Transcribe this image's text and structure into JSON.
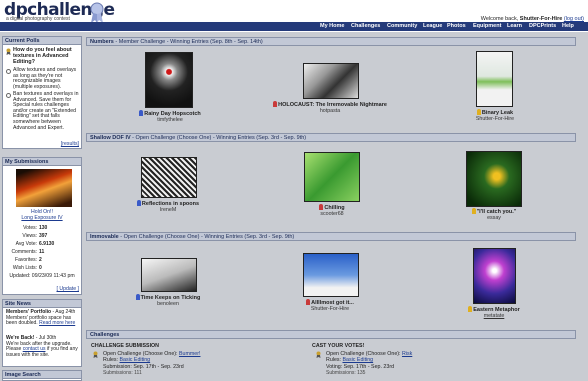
{
  "header": {
    "logo": "dpchallenge",
    "tagline": "a digital photography contest",
    "welcome_prefix": "Welcome back,",
    "username": "Shutter-For-Hire",
    "logout": "(log out)"
  },
  "nav": [
    "My Home",
    "Challenges",
    "Community",
    "League",
    "Photos",
    "Equipment",
    "Learn",
    "DPCPrints",
    "Help"
  ],
  "sidebar": {
    "polls_title": "Current Polls",
    "poll_question": "How do you feel about textures in Advanced Editing?",
    "poll_options": [
      "Allow textures and overlays as long as they're not recognizable images (multiple exposures).",
      "Ban textures and overlays in Advanced. Save them for Special rules challenges and/or create an \"Extended Editing\" set that falls somewhere between Advanced and Expert."
    ],
    "results_link": "[results]",
    "submissions_title": "My Submissions",
    "submission_status": "Hold On!!",
    "submission_challenge": "Long Exposure IV",
    "stats": [
      {
        "label": "Votes:",
        "value": "130"
      },
      {
        "label": "Views:",
        "value": "397"
      },
      {
        "label": "Avg Vote:",
        "value": "6.9130"
      },
      {
        "label": "Comments:",
        "value": "11"
      },
      {
        "label": "Favorites:",
        "value": "2"
      },
      {
        "label": "Wish Lists:",
        "value": "0"
      }
    ],
    "updated": "Updated: 09/23/09 11:43 pm",
    "update_link": "[ Update ]",
    "news_title": "Site News",
    "news_items": [
      {
        "headline": "Members' Portfolio",
        "date": "- Aug 24th",
        "text": "Members' portfolio space has been doubled.",
        "link": "Read more here"
      },
      {
        "headline": "We're Back!",
        "date": "- Jul 30th",
        "text": "We're back after the upgrade. Please",
        "link": "contact us",
        "text2": "if you find any issues with the site."
      }
    ],
    "image_search_title": "Image Search"
  },
  "sections": [
    {
      "name": "Numbers",
      "desc": " - Member Challenge - Winning Entries (Sep. 8th - Sep. 14th)",
      "entries": [
        {
          "title": "Rainy Day Hopscotch",
          "user": "timfythelee",
          "ribbon": "#3a5ac8"
        },
        {
          "title": "HOLOCAUST: The Irremovable Nightmare",
          "user": "hotpasta",
          "ribbon": "#c83a3a"
        },
        {
          "title": "Binary Leak",
          "user": "Shutter-For-Hire",
          "ribbon": "#e0b020"
        }
      ]
    },
    {
      "name": "Shallow DOF IV",
      "desc": " - Open Challenge (Choose One) - Winning Entries (Sep. 3rd - Sep. 9th)",
      "entries": [
        {
          "title": "Reflections in spoons",
          "user": "IreneM",
          "ribbon": "#3a5ac8"
        },
        {
          "title": "Chilling",
          "user": "scooter68",
          "ribbon": "#c83a3a"
        },
        {
          "title": "\"I'll catch you.\"",
          "user": "essay",
          "ribbon": "#e0b020"
        }
      ]
    },
    {
      "name": "Immovable",
      "desc": " - Open Challenge (Choose One) - Winning Entries (Sep. 3rd - Sep. 9th)",
      "entries": [
        {
          "title": "Time Keeps on Ticking",
          "user": "benoleen",
          "ribbon": "#3a5ac8"
        },
        {
          "title": "Allllmost got it...",
          "user": "Shutter-For-Hire",
          "ribbon": "#c83a3a"
        },
        {
          "title": "Eastern Metaphor",
          "user": "metatate",
          "ribbon": "#e0b020"
        }
      ]
    }
  ],
  "challenges": {
    "title": "Challenges",
    "submission_head": "CHALLENGE SUBMISSION",
    "submission_type": "Open Challenge (Choose One):",
    "submission_name": "Bummer!",
    "submission_rules_label": "Rules:",
    "submission_rules": "Basic Editing",
    "submission_dates": "Submission: Sep. 17th - Sep. 23rd",
    "submission_count": "Submissions: 111",
    "vote_head": "CAST YOUR VOTES!",
    "vote_type": "Open Challenge (Choose One):",
    "vote_name": "Risk",
    "vote_rules_label": "Rules:",
    "vote_rules": "Basic Editing",
    "vote_dates": "Voting: Sep. 17th - Sep. 23rd",
    "vote_count": "Submissions: 135"
  }
}
